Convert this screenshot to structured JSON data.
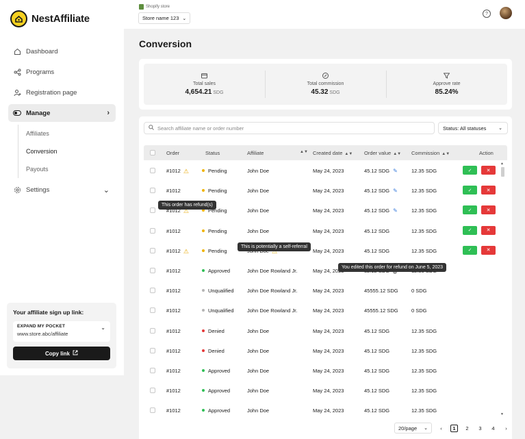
{
  "brand": {
    "name": "NestAffiliate"
  },
  "sidebar": {
    "items": [
      {
        "label": "Dashboard",
        "icon": "home-icon"
      },
      {
        "label": "Programs",
        "icon": "share-icon"
      },
      {
        "label": "Registration page",
        "icon": "user-plus-icon"
      },
      {
        "label": "Manage",
        "icon": "toggle-icon"
      },
      {
        "label": "Settings",
        "icon": "gear-icon"
      }
    ],
    "manage_sub": [
      {
        "label": "Affiliates"
      },
      {
        "label": "Conversion"
      },
      {
        "label": "Payouts"
      }
    ],
    "signup": {
      "title": "Your affiliate sign up link:",
      "store": "EXPAND MY POCKET",
      "url": "www.store.abc/affiliate",
      "copy_label": "Copy link"
    }
  },
  "topbar": {
    "store_label": "Shopify store",
    "store_name": "Store name 123"
  },
  "page": {
    "title": "Conversion"
  },
  "stats": [
    {
      "label": "Total sales",
      "value": "4,654.21",
      "unit": "SDG",
      "icon": "wallet-icon"
    },
    {
      "label": "Total commission",
      "value": "45.32",
      "unit": "SDG",
      "icon": "percent-icon"
    },
    {
      "label": "Approve rate",
      "value": "85.24%",
      "unit": "",
      "icon": "filter-icon"
    }
  ],
  "toolbar": {
    "search_placeholder": "Search affiliate name or order number",
    "status_filter": "Status: All statuses"
  },
  "table": {
    "columns": {
      "order": "Order",
      "status": "Status",
      "affiliate": "Affiliate",
      "created": "Created date",
      "value": "Order value",
      "commission": "Commission",
      "action": "Action"
    },
    "rows": [
      {
        "order": "#1012",
        "warn": true,
        "status": "Pending",
        "affiliate": "John Doe",
        "aff_warn": false,
        "date": "May 24, 2023",
        "value": "45.12 SDG",
        "value_icon": "edit",
        "commission": "12.35 SDG",
        "actions": true
      },
      {
        "order": "#1012",
        "warn": false,
        "status": "Pending",
        "affiliate": "John Doe",
        "aff_warn": false,
        "date": "May 24, 2023",
        "value": "45.12 SDG",
        "value_icon": "edit",
        "commission": "12.35 SDG",
        "actions": true
      },
      {
        "order": "#1012",
        "warn": true,
        "status": "Pending",
        "affiliate": "John Doe",
        "aff_warn": false,
        "date": "May 24, 2023",
        "value": "45.12 SDG",
        "value_icon": "edit",
        "commission": "12.35 SDG",
        "actions": true
      },
      {
        "order": "#1012",
        "warn": false,
        "status": "Pending",
        "affiliate": "John Doe",
        "aff_warn": false,
        "date": "May 24, 2023",
        "value": "45.12 SDG",
        "value_icon": "",
        "commission": "12.35 SDG",
        "actions": true
      },
      {
        "order": "#1012",
        "warn": true,
        "status": "Pending",
        "affiliate": "John Doe",
        "aff_warn": true,
        "date": "May 24, 2023",
        "value": "45.12 SDG",
        "value_icon": "",
        "commission": "12.35 SDG",
        "actions": true
      },
      {
        "order": "#1012",
        "warn": false,
        "status": "Approved",
        "affiliate": "John Doe Rowland Jr.",
        "aff_warn": false,
        "date": "May 24, 2023",
        "value": "32.12 SDG",
        "value_icon": "info",
        "commission": "12.35 SDG",
        "actions": false
      },
      {
        "order": "#1012",
        "warn": false,
        "status": "Unqualified",
        "affiliate": "John Doe Rowland Jr.",
        "aff_warn": false,
        "date": "May 24, 2023",
        "value": "45555.12 SDG",
        "value_icon": "",
        "commission": "0 SDG",
        "actions": false
      },
      {
        "order": "#1012",
        "warn": false,
        "status": "Unqualified",
        "affiliate": "John Doe Rowland Jr.",
        "aff_warn": false,
        "date": "May 24, 2023",
        "value": "45555.12 SDG",
        "value_icon": "",
        "commission": "0 SDG",
        "actions": false
      },
      {
        "order": "#1012",
        "warn": false,
        "status": "Denied",
        "affiliate": "John Doe",
        "aff_warn": false,
        "date": "May 24, 2023",
        "value": "45.12 SDG",
        "value_icon": "",
        "commission": "12.35 SDG",
        "actions": false
      },
      {
        "order": "#1012",
        "warn": false,
        "status": "Denied",
        "affiliate": "John Doe",
        "aff_warn": false,
        "date": "May 24, 2023",
        "value": "45.12 SDG",
        "value_icon": "",
        "commission": "12.35 SDG",
        "actions": false
      },
      {
        "order": "#1012",
        "warn": false,
        "status": "Approved",
        "affiliate": "John Doe",
        "aff_warn": false,
        "date": "May 24, 2023",
        "value": "45.12 SDG",
        "value_icon": "",
        "commission": "12.35 SDG",
        "actions": false
      },
      {
        "order": "#1012",
        "warn": false,
        "status": "Approved",
        "affiliate": "John Doe",
        "aff_warn": false,
        "date": "May 24, 2023",
        "value": "45.12 SDG",
        "value_icon": "",
        "commission": "12.35 SDG",
        "actions": false
      },
      {
        "order": "#1012",
        "warn": false,
        "status": "Approved",
        "affiliate": "John Doe",
        "aff_warn": false,
        "date": "May 24, 2023",
        "value": "45.12 SDG",
        "value_icon": "",
        "commission": "12.35 SDG",
        "actions": false
      }
    ]
  },
  "tooltips": {
    "refund": "This order has refund(s)",
    "self_referral": "This is potentially a self-referral",
    "edited": "You edited this order for refund on June 5, 2023"
  },
  "pagination": {
    "page_size": "20/page",
    "pages": [
      "1",
      "2",
      "3",
      "4"
    ]
  },
  "colors": {
    "pending": "#f0b400",
    "approved": "#2fbf55",
    "unqualified": "#b5b5b5",
    "denied": "#e53939"
  }
}
